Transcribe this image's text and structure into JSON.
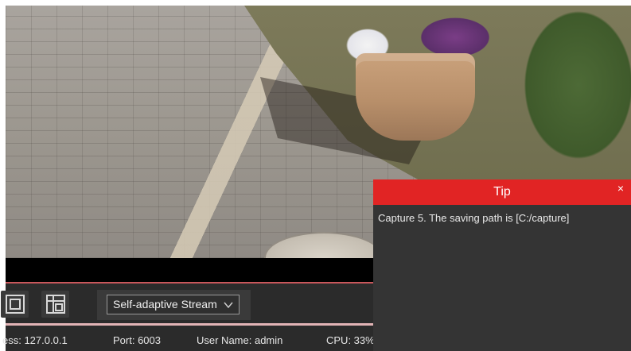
{
  "video": {
    "icon": "camera-live-view"
  },
  "toolbar": {
    "stream_mode": "Self-adaptive Stream",
    "colors": {
      "background": "#2b2b2b",
      "button": "#3a3a3a"
    }
  },
  "statusbar": {
    "address": "ess: 127.0.0.1",
    "port": "Port: 6003",
    "user": "User Name: admin",
    "cpu": "CPU: 33%"
  },
  "tip": {
    "title": "Tip",
    "close_label": "×",
    "message": "Capture 5. The saving path is [C:/capture]",
    "colors": {
      "header": "#e12424",
      "body": "#343434"
    }
  }
}
